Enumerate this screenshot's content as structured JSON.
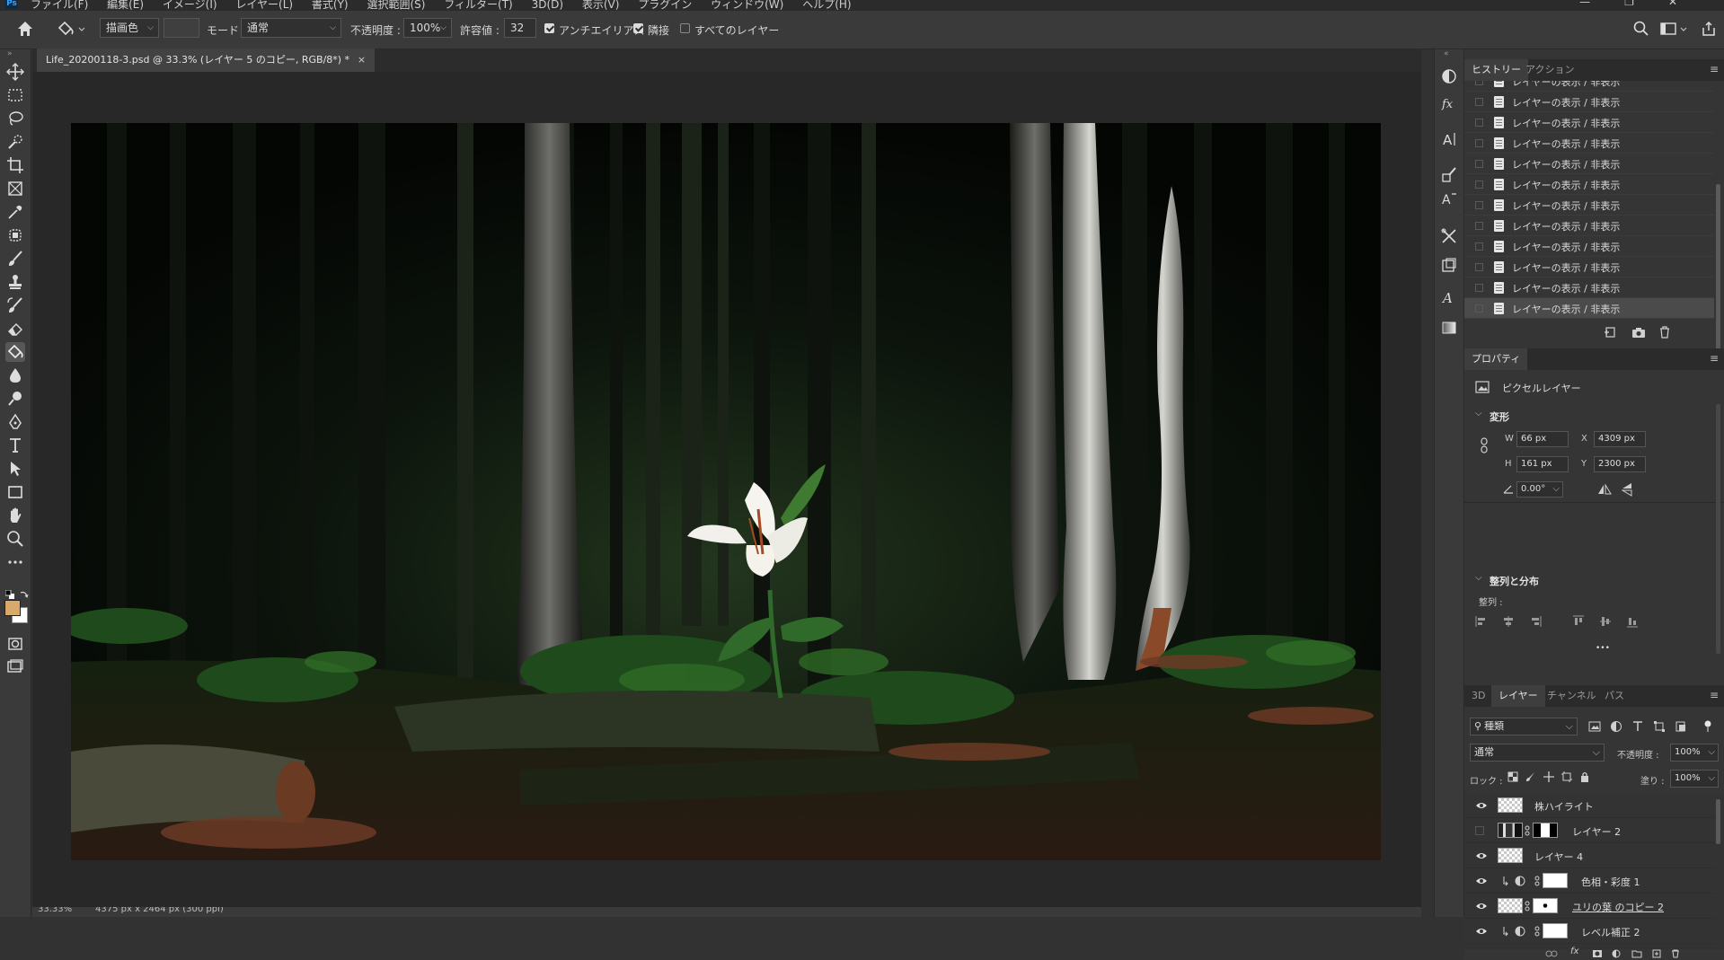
{
  "app": {
    "logo": "Ps",
    "menu": [
      "ファイル(F)",
      "編集(E)",
      "イメージ(I)",
      "レイヤー(L)",
      "書式(Y)",
      "選択範囲(S)",
      "フィルター(T)",
      "3D(D)",
      "表示(V)",
      "プラグイン",
      "ウィンドウ(W)",
      "ヘルプ(H)"
    ],
    "window_buttons": [
      "—",
      "❐",
      "✕"
    ]
  },
  "options": {
    "fill_source": "描画色",
    "mode_label": "モード :",
    "mode_value": "通常",
    "opacity_label": "不透明度 :",
    "opacity_value": "100%",
    "tolerance_label": "許容値 :",
    "tolerance_value": "32",
    "antialias_label": "アンチエイリアス",
    "antialias_checked": true,
    "contiguous_label": "隣接",
    "contiguous_checked": true,
    "all_layers_label": "すべてのレイヤー",
    "all_layers_checked": false
  },
  "document": {
    "tab_title": "Life_20200118-3.psd @ 33.3% (レイヤー 5 のコピー, RGB/8*) *",
    "close": "×",
    "zoom": "33.33%",
    "dimensions": "4375 px x 2464 px (300 ppi)"
  },
  "colors": {
    "foreground": "#d9a86b",
    "background": "#ffffff",
    "accent": "#31a8ff"
  },
  "history": {
    "tabs": [
      "ヒストリー",
      "アクション"
    ],
    "items": [
      "レイヤーの表示 / 非表示",
      "レイヤーの表示 / 非表示",
      "レイヤーの表示 / 非表示",
      "レイヤーの表示 / 非表示",
      "レイヤーの表示 / 非表示",
      "レイヤーの表示 / 非表示",
      "レイヤーの表示 / 非表示",
      "レイヤーの表示 / 非表示",
      "レイヤーの表示 / 非表示",
      "レイヤーの表示 / 非表示",
      "レイヤーの表示 / 非表示",
      "レイヤーの表示 / 非表示"
    ]
  },
  "properties": {
    "tab": "プロパティ",
    "kind": "ピクセルレイヤー",
    "transform_title": "変形",
    "w_label": "W",
    "w": "66 px",
    "h_label": "H",
    "h": "161 px",
    "x_label": "X",
    "x": "4309 px",
    "y_label": "Y",
    "y": "2300 px",
    "angle": "0.00°",
    "align_title": "整列と分布",
    "align_label": "整列 :",
    "more": "•••"
  },
  "layers_panel": {
    "tabs": [
      "3D",
      "レイヤー",
      "チャンネル",
      "パス"
    ],
    "filter_kind": "種類",
    "blend_mode": "通常",
    "opacity_label": "不透明度 :",
    "opacity": "100%",
    "lock_label": "ロック :",
    "fill_label": "塗り :",
    "fill": "100%",
    "layers": [
      {
        "name": "株ハイライト",
        "visible": true
      },
      {
        "name": "レイヤー 2",
        "visible": false
      },
      {
        "name": "レイヤー 4",
        "visible": true
      },
      {
        "name": "色相・彩度 1",
        "visible": true
      },
      {
        "name": "ユリの葉 のコピー 2",
        "visible": true
      },
      {
        "name": "レベル補正 2",
        "visible": true
      }
    ]
  }
}
